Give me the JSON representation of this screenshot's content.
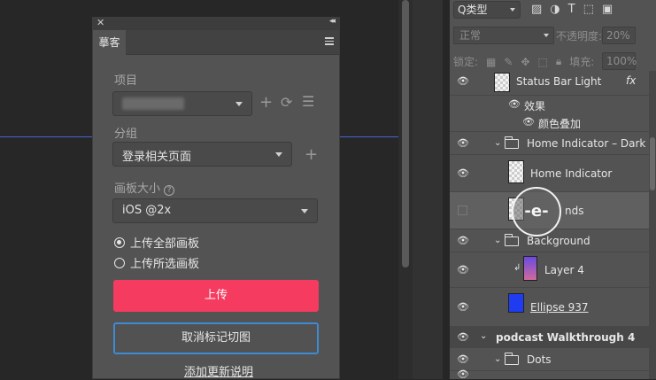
{
  "plugin": {
    "tab": "摹客",
    "project_label": "项目",
    "group_label": "分组",
    "group_value": "登录相关页面",
    "artboard_label": "画板大小",
    "artboard_value": "iOS @2x",
    "radio_all": "上传全部画板",
    "radio_selected": "上传所选画板",
    "upload_button": "上传",
    "cancel_button": "取消标记切图",
    "update_link": "添加更新说明"
  },
  "layers_panel": {
    "filter_label": "Q类型",
    "blend_mode": "正常",
    "opacity_label": "不透明度:",
    "opacity_value": "20%",
    "lock_label": "锁定:",
    "fill_label": "填充:",
    "fill_value": "100%",
    "rows": [
      {
        "name": "Status Bar Light",
        "fx": "fx"
      },
      {
        "name": "效果"
      },
      {
        "name": "颜色叠加"
      },
      {
        "name": "Home Indicator – Dark"
      },
      {
        "name": "Home Indicator"
      },
      {
        "name": "nds"
      },
      {
        "name": "Background"
      },
      {
        "name": "Layer 4"
      },
      {
        "name": "Ellipse 937"
      },
      {
        "name": "podcast Walkthrough 4"
      },
      {
        "name": "Dots"
      }
    ]
  },
  "cursor_label": "-e-",
  "colors": {
    "upload": "#f53b60",
    "cancel_border": "#3e8ad3",
    "guide": "#4a63d8",
    "ellipse": "#1f3cf0"
  }
}
